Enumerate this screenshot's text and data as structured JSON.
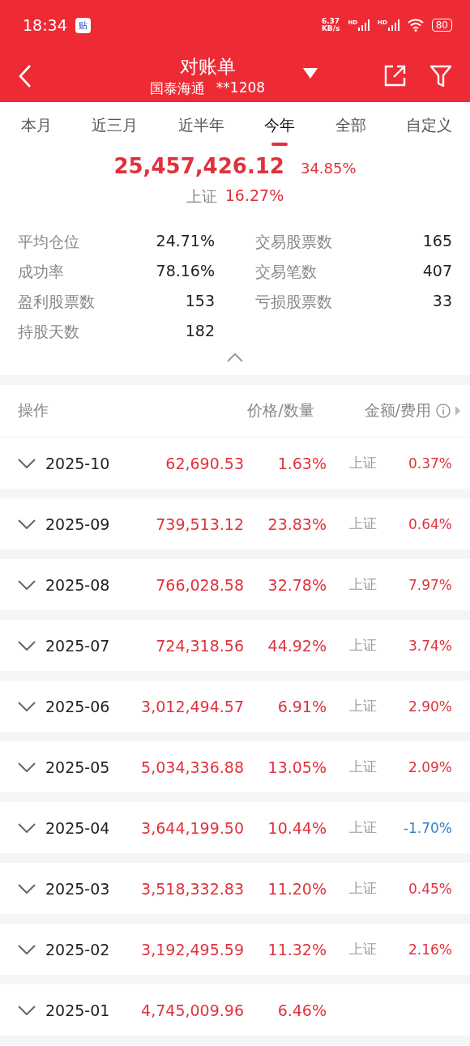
{
  "status_bar": {
    "time": "18:34",
    "app_badge": "贴",
    "net_speed": "6.37\nKB/s",
    "signal_1": "HD",
    "signal_2": "HD",
    "battery": "80"
  },
  "header": {
    "title": "对账单",
    "broker": "国泰海通",
    "account": "**1208"
  },
  "tabs": [
    {
      "label": "本月",
      "selected": false
    },
    {
      "label": "近三月",
      "selected": false
    },
    {
      "label": "近半年",
      "selected": false
    },
    {
      "label": "今年",
      "selected": true
    },
    {
      "label": "全部",
      "selected": false
    },
    {
      "label": "自定义",
      "selected": false
    }
  ],
  "summary": {
    "total": "25,457,426.12",
    "total_pct": "34.85%",
    "index_label": "上证",
    "index_pct": "16.27%"
  },
  "stats": [
    {
      "label": "平均仓位",
      "value": "24.71%"
    },
    {
      "label": "交易股票数",
      "value": "165"
    },
    {
      "label": "成功率",
      "value": "78.16%"
    },
    {
      "label": "交易笔数",
      "value": "407"
    },
    {
      "label": "盈利股票数",
      "value": "153"
    },
    {
      "label": "亏损股票数",
      "value": "33"
    },
    {
      "label": "持股天数",
      "value": "182"
    }
  ],
  "table": {
    "columns": [
      "操作",
      "价格/数量",
      "金额/费用"
    ],
    "rows": [
      {
        "month": "2025-10",
        "amount": "62,690.53",
        "pct": "1.63%",
        "index_label": "上证",
        "index_pct": "0.37%",
        "color": "#e0323c"
      },
      {
        "month": "2025-09",
        "amount": "739,513.12",
        "pct": "23.83%",
        "index_label": "上证",
        "index_pct": "0.64%",
        "color": "#e0323c"
      },
      {
        "month": "2025-08",
        "amount": "766,028.58",
        "pct": "32.78%",
        "index_label": "上证",
        "index_pct": "7.97%",
        "color": "#e0323c"
      },
      {
        "month": "2025-07",
        "amount": "724,318.56",
        "pct": "44.92%",
        "index_label": "上证",
        "index_pct": "3.74%",
        "color": "#e0323c"
      },
      {
        "month": "2025-06",
        "amount": "3,012,494.57",
        "pct": "6.91%",
        "index_label": "上证",
        "index_pct": "2.90%",
        "color": "#e0323c"
      },
      {
        "month": "2025-05",
        "amount": "5,034,336.88",
        "pct": "13.05%",
        "index_label": "上证",
        "index_pct": "2.09%",
        "color": "#e0323c"
      },
      {
        "month": "2025-04",
        "amount": "3,644,199.50",
        "pct": "10.44%",
        "index_label": "上证",
        "index_pct": "-1.70%",
        "color": "#3a7fc1"
      },
      {
        "month": "2025-03",
        "amount": "3,518,332.83",
        "pct": "11.20%",
        "index_label": "上证",
        "index_pct": "0.45%",
        "color": "#e0323c"
      },
      {
        "month": "2025-02",
        "amount": "3,192,495.59",
        "pct": "11.32%",
        "index_label": "上证",
        "index_pct": "2.16%",
        "color": "#e0323c"
      },
      {
        "month": "2025-01",
        "amount": "4,745,009.96",
        "pct": "6.46%"
      }
    ]
  }
}
